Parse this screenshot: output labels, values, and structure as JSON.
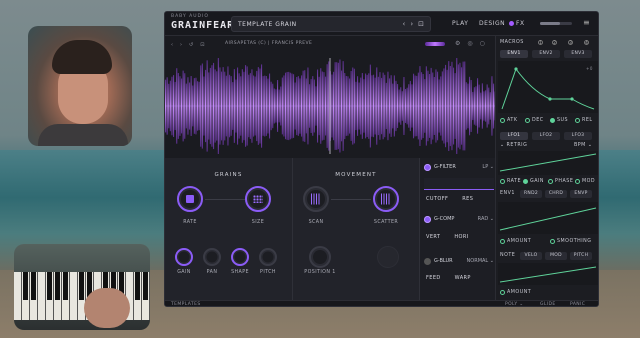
{
  "plugin": {
    "maker": "BABY AUDIO",
    "name": "GRAINFEARO",
    "preset": "TEMPLATE GRAIN",
    "preset_nav": [
      "‹",
      "›",
      "⊡"
    ],
    "tabs": {
      "play": "PLAY",
      "design": "DESIGN",
      "fx": "FX"
    },
    "menu_icon": "hamburger-icon"
  },
  "wave": {
    "controls": [
      "‹",
      "›",
      "↺",
      "⊡"
    ],
    "sample_name": "AIRSAPETAS (C) | FRANCIS PREVE",
    "icons": [
      "⚙",
      "◎",
      "○"
    ]
  },
  "grains": {
    "title": "GRAINS",
    "knobs": {
      "rate": "RATE",
      "size": "SIZE",
      "gain": "GAIN",
      "pan": "PAN",
      "shape": "SHAPE",
      "pitch": "PITCH"
    }
  },
  "movement": {
    "title": "MOVEMENT",
    "knobs": {
      "scan": "SCAN",
      "scatter": "SCATTER",
      "position": "POSITION 1"
    }
  },
  "fx": {
    "filter": {
      "label": "G-FILTER",
      "mode": "LP ⌄",
      "p1": "CUTOFF",
      "p2": "RES"
    },
    "comp": {
      "label": "G-COMP",
      "mode": "RAD ⌄",
      "p1": "VERT",
      "p2": "HORI"
    },
    "blur": {
      "label": "G-BLUR",
      "mode": "NORMAL ⌄",
      "p1": "FEED",
      "p2": "WARP"
    }
  },
  "right": {
    "macros": "MACROS",
    "macro_nums": [
      "1",
      "2",
      "3",
      "4"
    ],
    "env_tabs": [
      "ENV1",
      "ENV2",
      "ENV3"
    ],
    "env_knobs": [
      "ATK",
      "DEC",
      "SUS",
      "REL"
    ],
    "env_value": "+0",
    "lfo_tabs": [
      "LFO1",
      "LFO2",
      "LFO3"
    ],
    "retrig": "RETRIG",
    "bpm": "BPM ⌄",
    "lfo_knobs": [
      "RATE",
      "GAIN",
      "PHASE",
      "MOD"
    ],
    "src_label": "ENV1",
    "src_tabs": [
      "RND2",
      "CHRD",
      "ENVP"
    ],
    "amount1": "AMOUNT",
    "smoothing": "SMOOTHING",
    "note": "NOTE",
    "note_tabs": [
      "VELO",
      "MOD",
      "PITCH"
    ],
    "amount2": "AMOUNT"
  },
  "bottom": {
    "templates": "TEMPLATES",
    "poly": "POLY ⌄",
    "glide": "GLIDE",
    "panic": "PANIC"
  },
  "colors": {
    "accent": "#8b5cf6",
    "mod": "#5fd39a",
    "panel": "#1e1f25"
  }
}
